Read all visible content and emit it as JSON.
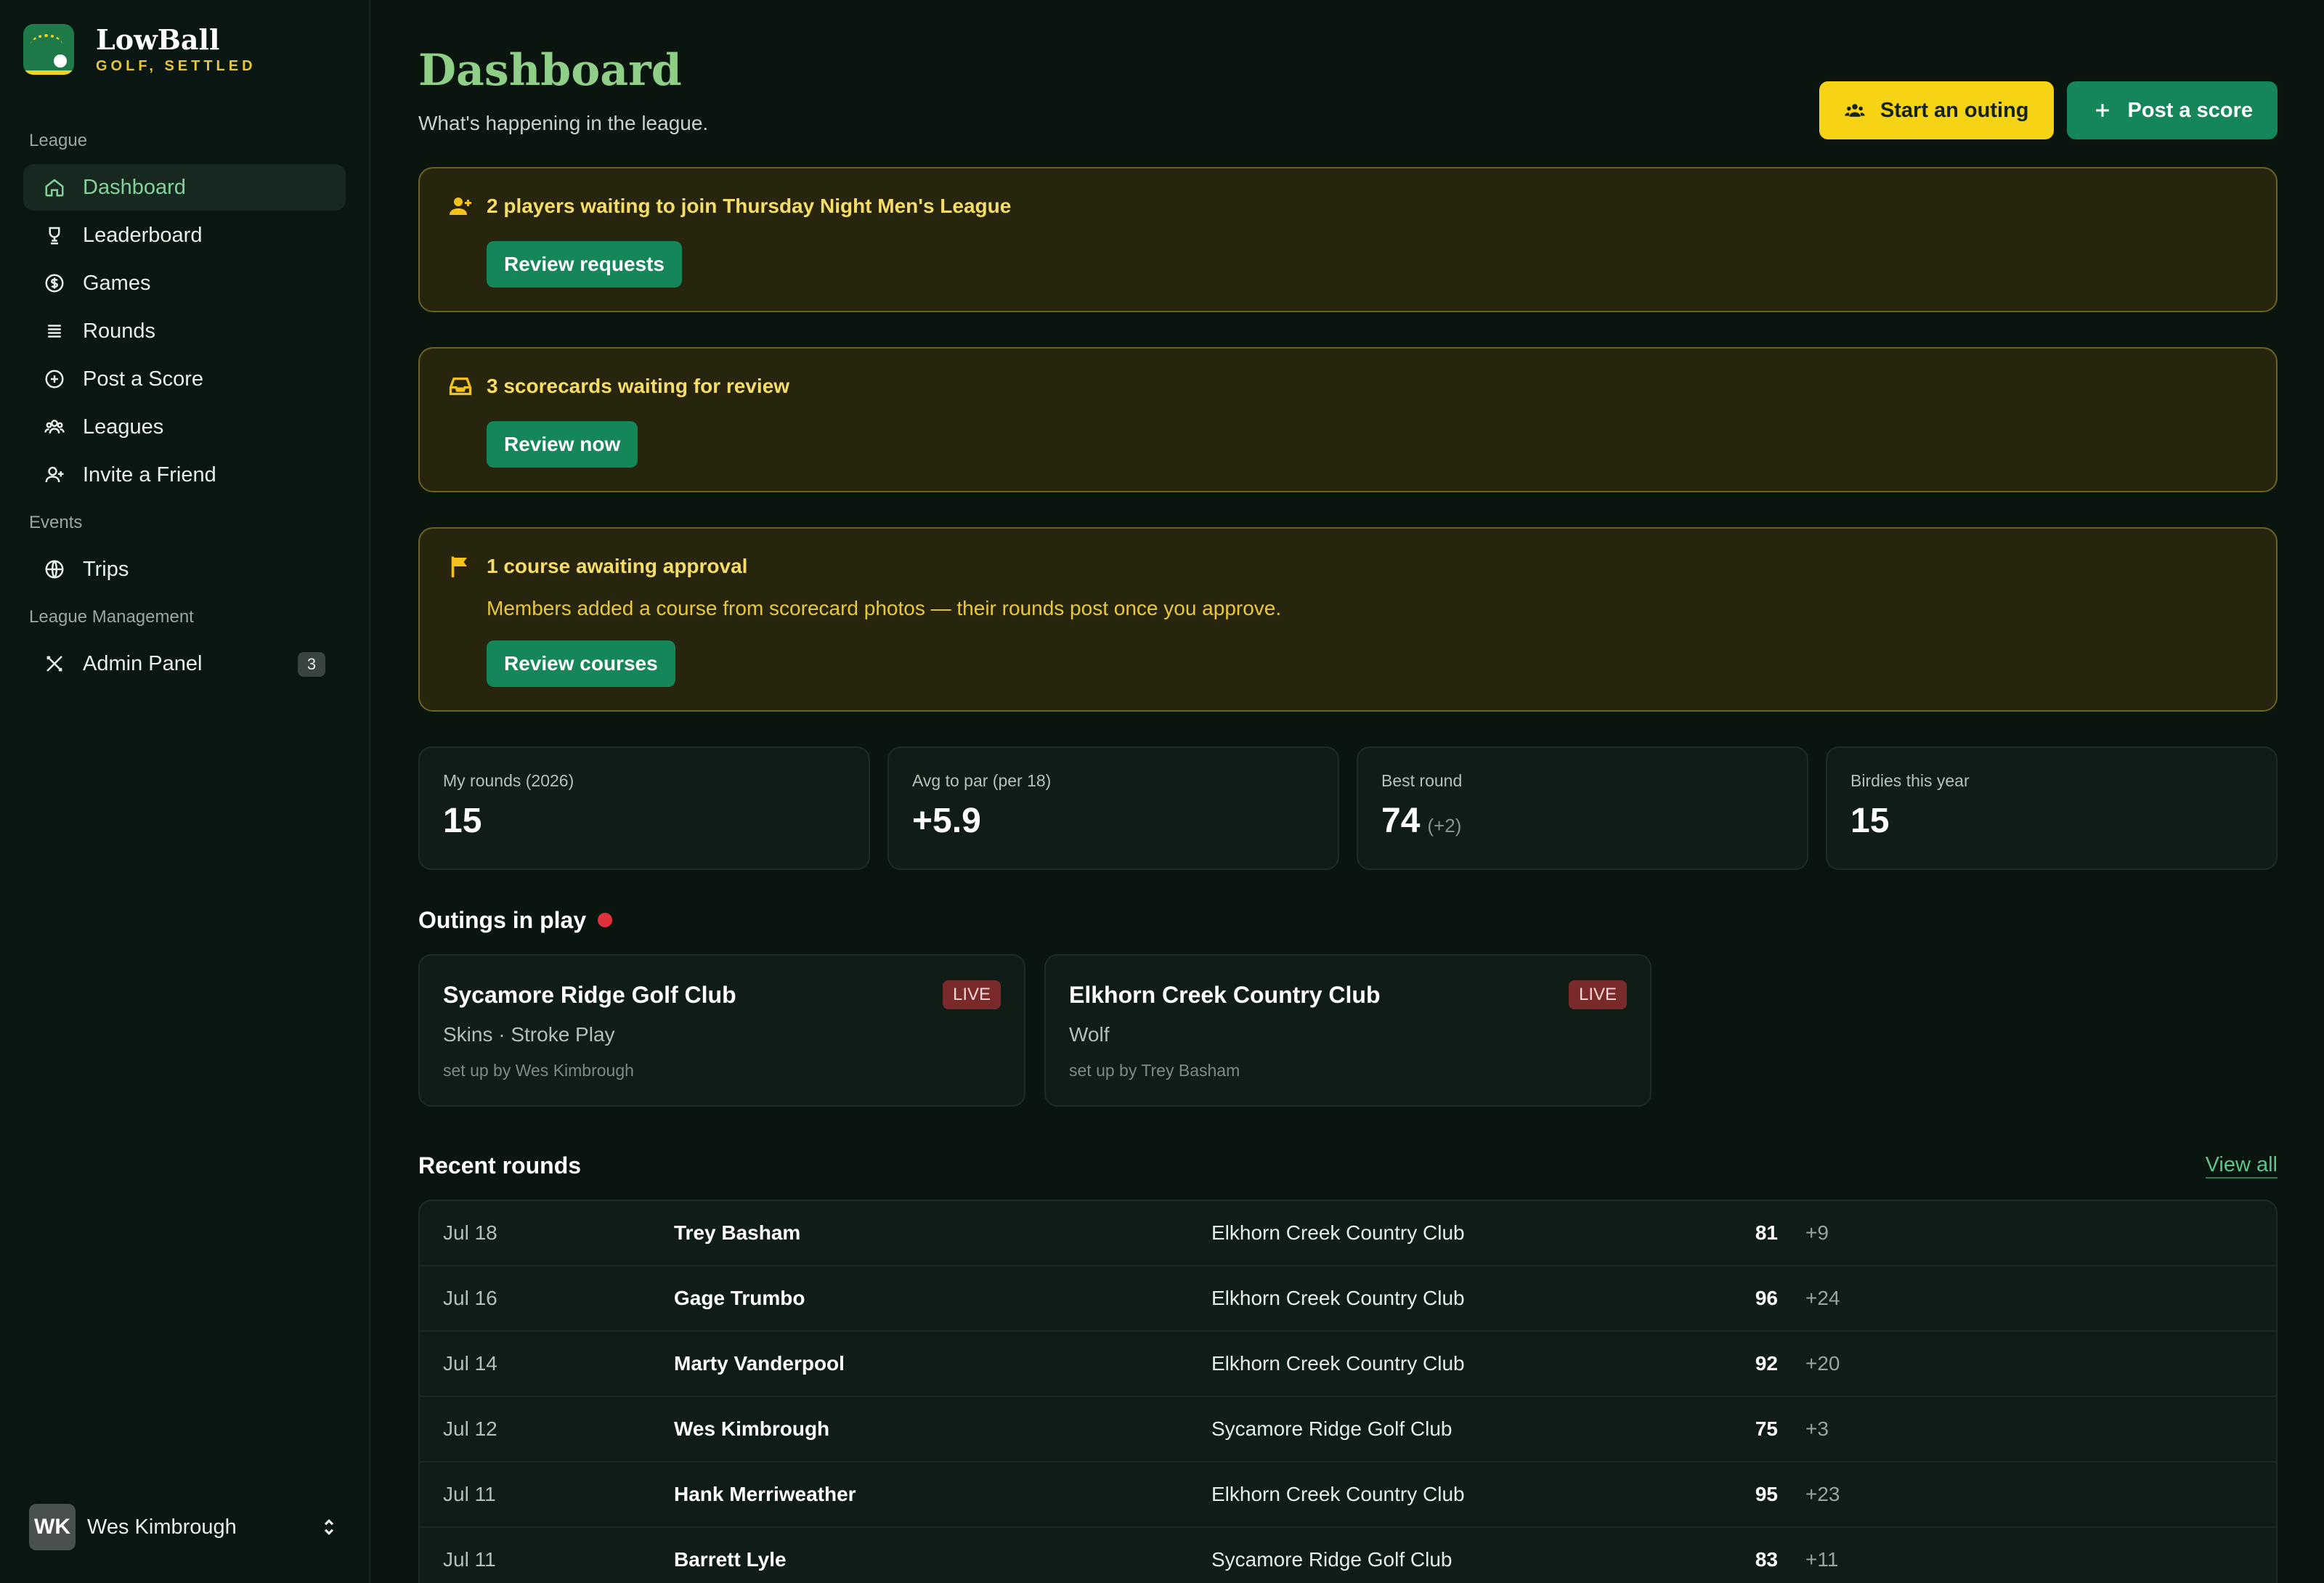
{
  "brand": {
    "name": "LowBall",
    "tagline": "GOLF, SETTLED"
  },
  "sidebar": {
    "sections": [
      {
        "label": "League",
        "items": [
          {
            "label": "Dashboard",
            "icon": "home-icon",
            "active": true
          },
          {
            "label": "Leaderboard",
            "icon": "trophy-icon"
          },
          {
            "label": "Games",
            "icon": "dollar-icon"
          },
          {
            "label": "Rounds",
            "icon": "list-icon"
          },
          {
            "label": "Post a Score",
            "icon": "plus-circle-icon"
          },
          {
            "label": "Leagues",
            "icon": "users-icon"
          },
          {
            "label": "Invite a Friend",
            "icon": "user-plus-icon"
          }
        ]
      },
      {
        "label": "Events",
        "items": [
          {
            "label": "Trips",
            "icon": "globe-icon"
          }
        ]
      },
      {
        "label": "League Management",
        "items": [
          {
            "label": "Admin Panel",
            "icon": "tools-icon",
            "badge": "3"
          }
        ]
      }
    ],
    "user": {
      "initials": "WK",
      "name": "Wes Kimbrough"
    }
  },
  "header": {
    "title": "Dashboard",
    "subtitle": "What's happening in the league.",
    "start_outing": "Start an outing",
    "post_score": "Post a score"
  },
  "alerts": [
    {
      "title": "2 players waiting to join Thursday Night Men's League",
      "desc": "",
      "button": "Review requests",
      "icon": "user-plus-icon"
    },
    {
      "title": "3 scorecards waiting for review",
      "desc": "",
      "button": "Review now",
      "icon": "inbox-icon"
    },
    {
      "title": "1 course awaiting approval",
      "desc": "Members added a course from scorecard photos — their rounds post once you approve.",
      "button": "Review courses",
      "icon": "flag-icon"
    }
  ],
  "stats": [
    {
      "label": "My rounds (2026)",
      "value": "15",
      "extra": ""
    },
    {
      "label": "Avg to par (per 18)",
      "value": "+5.9",
      "extra": ""
    },
    {
      "label": "Best round",
      "value": "74",
      "extra": "(+2)"
    },
    {
      "label": "Birdies this year",
      "value": "15",
      "extra": ""
    }
  ],
  "outings": {
    "heading": "Outings in play",
    "items": [
      {
        "name": "Sycamore Ridge Golf Club",
        "games": "Skins · Stroke Play",
        "by": "set up by Wes Kimbrough",
        "status": "LIVE"
      },
      {
        "name": "Elkhorn Creek Country Club",
        "games": "Wolf",
        "by": "set up by Trey Basham",
        "status": "LIVE"
      }
    ]
  },
  "recent": {
    "heading": "Recent rounds",
    "view_all": "View all",
    "rows": [
      {
        "date": "Jul 18",
        "player": "Trey Basham",
        "course": "Elkhorn Creek Country Club",
        "score": "81",
        "to_par": "+9"
      },
      {
        "date": "Jul 16",
        "player": "Gage Trumbo",
        "course": "Elkhorn Creek Country Club",
        "score": "96",
        "to_par": "+24"
      },
      {
        "date": "Jul 14",
        "player": "Marty Vanderpool",
        "course": "Elkhorn Creek Country Club",
        "score": "92",
        "to_par": "+20"
      },
      {
        "date": "Jul 12",
        "player": "Wes Kimbrough",
        "course": "Sycamore Ridge Golf Club",
        "score": "75",
        "to_par": "+3"
      },
      {
        "date": "Jul 11",
        "player": "Hank Merriweather",
        "course": "Elkhorn Creek Country Club",
        "score": "95",
        "to_par": "+23"
      },
      {
        "date": "Jul 11",
        "player": "Barrett Lyle",
        "course": "Sycamore Ridge Golf Club",
        "score": "83",
        "to_par": "+11"
      }
    ]
  },
  "colors": {
    "accent": "#15855a",
    "yellow": "#f7d316",
    "live": "#7a2a2a",
    "bg": "#0b1510"
  }
}
